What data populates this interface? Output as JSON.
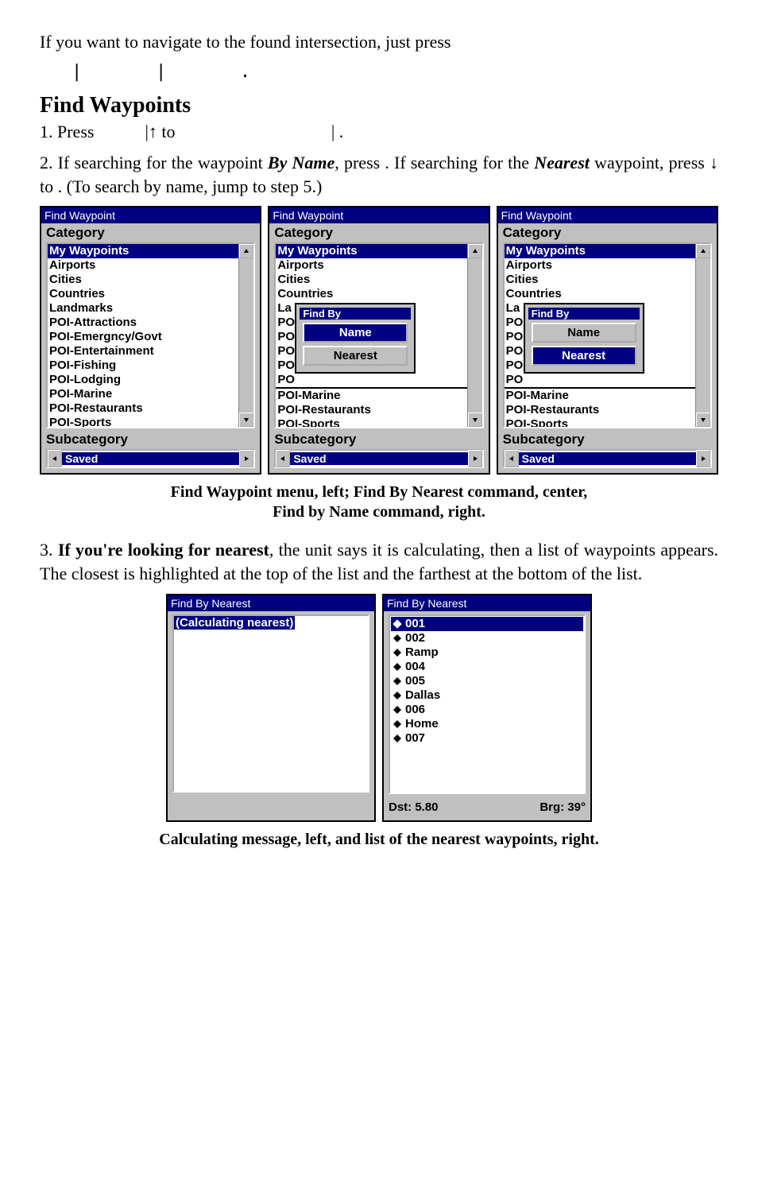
{
  "para1": "If you want to navigate to the found intersection, just press",
  "para1_spacer": "|       |       .",
  "heading": "Find Waypoints",
  "step1_a": "1. Press",
  "step1_b": "|↑ to",
  "step1_c": "|       .",
  "step2_a": "2. If searching for the waypoint ",
  "step2_byname": "By Name",
  "step2_b": ", press      . If searching for the ",
  "step2_nearest": "Nearest",
  "step2_c": " waypoint, press ↓ to                 . (To search by name, jump to step 5.)",
  "caption1_line1": "Find Waypoint menu, left; Find By Nearest command, center,",
  "caption1_line2": "Find by Name command, right.",
  "step3_a": "3. ",
  "step3_bold": "If you're looking for nearest",
  "step3_b": ", the unit says it is calculating, then a list of waypoints appears. The closest is highlighted at the top of the list and the farthest at the bottom of the list.",
  "caption2": "Calculating message, left, and list of the nearest waypoints, right.",
  "win": {
    "title": "Find Waypoint",
    "catLabel": "Category",
    "subLabel": "Subcategory",
    "subValue": "Saved",
    "itemsFull": [
      "My Waypoints",
      "Airports",
      "Cities",
      "Countries",
      "Landmarks",
      "POI-Attractions",
      "POI-Emergncy/Govt",
      "POI-Entertainment",
      "POI-Fishing",
      "POI-Lodging",
      "POI-Marine",
      "POI-Restaurants",
      "POI-Sports"
    ],
    "itemsPartial": [
      "My Waypoints",
      "Airports",
      "Cities",
      "Countries",
      "La",
      "PO",
      "PO",
      "PO",
      "PO",
      "PO",
      "POI-Marine",
      "POI-Restaurants",
      "POI-Sports"
    ],
    "popup": {
      "title": "Find By",
      "nameBtn": "Name",
      "nearestBtn": "Nearest"
    }
  },
  "nearest": {
    "title": "Find By Nearest",
    "calc": "(Calculating nearest)",
    "items": [
      "001",
      "002",
      "Ramp",
      "004",
      "005",
      "Dallas",
      "006",
      "Home",
      "007"
    ],
    "dst": "Dst: 5.80",
    "brg": "Brg: 39°"
  }
}
